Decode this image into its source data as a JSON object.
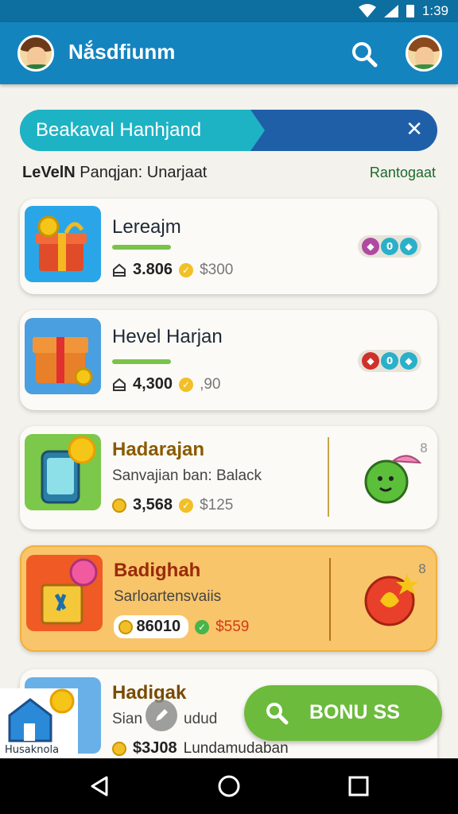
{
  "status": {
    "time": "1:39"
  },
  "appbar": {
    "title": "Nắsdfiunm"
  },
  "banner": {
    "text": "Beakaval Hanhjand",
    "close": "✕"
  },
  "subheader": {
    "level": "LeVelN",
    "rest": " Panqjan: Unarjaat",
    "link": "Rantogaat"
  },
  "cards": [
    {
      "title": "Lereajm",
      "count": "3.806",
      "price": "$300",
      "badges": [
        "◆",
        "0",
        "◆"
      ]
    },
    {
      "title": "Hevel Harjan",
      "count": "4,300",
      "price": ",90",
      "badges": [
        "◆",
        "0",
        "◆"
      ]
    },
    {
      "title": "Hadarajan",
      "subtitle": "Sanvajian ban: Balack",
      "count": "3,568",
      "price": "$125",
      "corner": "8"
    },
    {
      "title": "Badighah",
      "subtitle": "Sarloartensvaiis",
      "count": "86010",
      "price": "$559",
      "corner": "8"
    },
    {
      "title": "Hadigak",
      "subtitle": "Sian",
      "subtitle_right": "udud",
      "count": "$3J08",
      "price": "Lundamudaban"
    }
  ],
  "bottom": {
    "home_label": "Husaknola",
    "bonus_label": "BONU SS"
  },
  "colors": {
    "primary": "#1484bf",
    "accent_green": "#6cbb3c",
    "orange_card": "#f8c56a"
  }
}
